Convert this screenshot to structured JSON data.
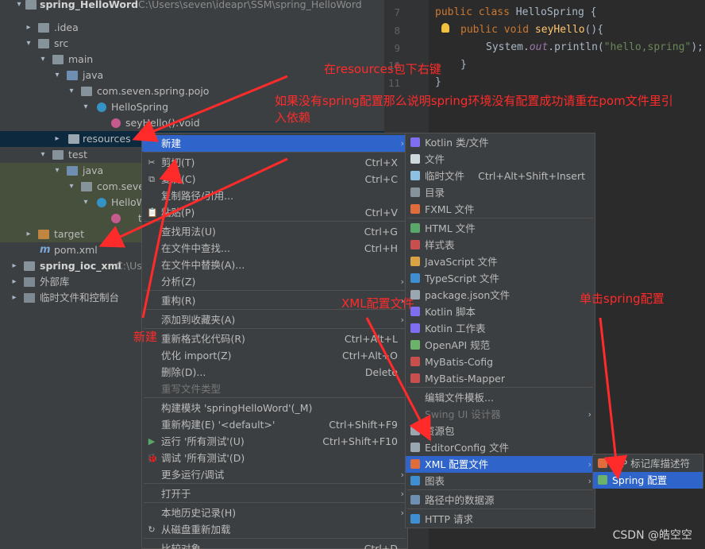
{
  "project_tree": {
    "root_name": "spring_HelloWord",
    "root_path": "C:\\Users\\seven\\ideapr\\SSM\\spring_HelloWord",
    "idea": ".idea",
    "src": "src",
    "main": "main",
    "java": "java",
    "package": "com.seven.spring.pojo",
    "class_name": "HelloSpring",
    "method": "seyHello():void",
    "resources": "resources",
    "test": "test",
    "test_java": "java",
    "test_package": "com.seven",
    "test_class": "HelloW",
    "test_method": "t",
    "target": "target",
    "pom": "pom.xml",
    "module2": "spring_ioc_xml",
    "module2_path": "C:\\Us",
    "ext_libs": "外部库",
    "scratches": "临时文件和控制台"
  },
  "editor": {
    "line_numbers": [
      "7",
      "8",
      "9",
      "10",
      "11"
    ],
    "l7_kw": "public class",
    "l7_name": "HelloSpring {",
    "l8_kw": "public void",
    "l8_fn": "seyHello",
    "l8_rest": "(){",
    "l9_a": "System.",
    "l9_out": "out",
    "l9_b": ".println(",
    "l9_str": "\"hello,spring\"",
    "l9_c": ");",
    "l10": "}",
    "l11": "}"
  },
  "context_menu": {
    "items": [
      {
        "label": "新建",
        "shortcut": "",
        "submenu": true
      },
      {
        "label": "剪切(T)",
        "shortcut": "Ctrl+X",
        "icon": "✂"
      },
      {
        "label": "复制(C)",
        "shortcut": "Ctrl+C",
        "icon": "⧉"
      },
      {
        "label": "复制路径/引用...",
        "shortcut": ""
      },
      {
        "label": "粘贴(P)",
        "shortcut": "Ctrl+V",
        "icon": "📋"
      },
      {
        "label": "查找用法(U)",
        "shortcut": "Ctrl+G"
      },
      {
        "label": "在文件中查找...",
        "shortcut": "Ctrl+H"
      },
      {
        "label": "在文件中替换(A)...",
        "shortcut": ""
      },
      {
        "label": "分析(Z)",
        "shortcut": "",
        "submenu": true
      },
      {
        "label": "重构(R)",
        "shortcut": "",
        "submenu": true
      },
      {
        "label": "添加到收藏夹(A)",
        "shortcut": "",
        "submenu": true
      },
      {
        "label": "重新格式化代码(R)",
        "shortcut": "Ctrl+Alt+L"
      },
      {
        "label": "优化 import(Z)",
        "shortcut": "Ctrl+Alt+O"
      },
      {
        "label": "删除(D)...",
        "shortcut": "Delete"
      },
      {
        "label": "重写文件类型",
        "shortcut": "",
        "disabled": true
      },
      {
        "label": "构建模块 'springHelloWord'(_M)",
        "shortcut": ""
      },
      {
        "label": "重新构建(E) '<default>'",
        "shortcut": "Ctrl+Shift+F9"
      },
      {
        "label": "运行 '所有测试'(U)",
        "shortcut": "Ctrl+Shift+F10",
        "icon": "▶"
      },
      {
        "label": "调试 '所有测试'(D)",
        "shortcut": "",
        "icon": "🐞"
      },
      {
        "label": "更多运行/调试",
        "shortcut": "",
        "submenu": true
      },
      {
        "label": "打开于",
        "shortcut": "",
        "submenu": true
      },
      {
        "label": "本地历史记录(H)",
        "shortcut": "",
        "submenu": true
      },
      {
        "label": "从磁盘重新加载",
        "shortcut": "",
        "icon": "↻"
      },
      {
        "label": "比较对象",
        "shortcut": "Ctrl+D"
      }
    ]
  },
  "new_submenu": {
    "items": [
      {
        "label": "Kotlin 类/文件",
        "icon_color": "#7f6df2",
        "shortcut": ""
      },
      {
        "label": "文件",
        "icon_color": "#cfd8dc",
        "shortcut": ""
      },
      {
        "label": "临时文件",
        "icon_color": "#8ec0e4",
        "shortcut": "Ctrl+Alt+Shift+Insert"
      },
      {
        "label": "目录",
        "icon_color": "#87939a",
        "shortcut": ""
      },
      {
        "label": "FXML 文件",
        "icon_color": "#e06c3c",
        "shortcut": ""
      },
      {
        "label": "HTML 文件",
        "icon_color": "#59a869",
        "shortcut": ""
      },
      {
        "label": "样式表",
        "icon_color": "#c94f4f",
        "shortcut": ""
      },
      {
        "label": "JavaScript 文件",
        "icon_color": "#d9a343",
        "shortcut": ""
      },
      {
        "label": "TypeScript 文件",
        "icon_color": "#3f8ed1",
        "shortcut": ""
      },
      {
        "label": "package.json文件",
        "icon_color": "#9aa7b0",
        "shortcut": ""
      },
      {
        "label": "Kotlin 脚本",
        "icon_color": "#7f6df2",
        "shortcut": ""
      },
      {
        "label": "Kotlin 工作表",
        "icon_color": "#7f6df2",
        "shortcut": ""
      },
      {
        "label": "OpenAPI 规范",
        "icon_color": "#6bb36b",
        "shortcut": ""
      },
      {
        "label": "MyBatis-Cofig",
        "icon_color": "#c94f4f",
        "shortcut": ""
      },
      {
        "label": "MyBatis-Mapper",
        "icon_color": "#c94f4f",
        "shortcut": ""
      },
      {
        "label": "编辑文件模板...",
        "icon_color": "",
        "shortcut": ""
      },
      {
        "label": "Swing UI 设计器",
        "icon_color": "",
        "shortcut": "",
        "disabled": true,
        "submenu": true
      },
      {
        "label": "资源包",
        "icon_color": "#9aa7b0",
        "shortcut": ""
      },
      {
        "label": "EditorConfig 文件",
        "icon_color": "#9aa7b0",
        "shortcut": ""
      },
      {
        "label": "XML 配置文件",
        "icon_color": "#e06c3c",
        "shortcut": "",
        "submenu": true,
        "selected": true
      },
      {
        "label": "图表",
        "icon_color": "#3f8ed1",
        "shortcut": "",
        "submenu": true
      },
      {
        "label": "路径中的数据源",
        "icon_color": "#6e8fb2",
        "shortcut": ""
      },
      {
        "label": "HTTP 请求",
        "icon_color": "#3f8ed1",
        "shortcut": ""
      }
    ]
  },
  "xml_submenu": {
    "items": [
      {
        "label": "JSP 标记库描述符",
        "selected": false
      },
      {
        "label": "Spring 配置",
        "selected": true
      }
    ]
  },
  "annotations": {
    "a1": "在resources包下右键",
    "a2_line1": "如果没有spring配置那么说明spring环境没有配置成功请重在pom文件里引",
    "a2_line2": "入依赖",
    "a3": "新建",
    "a4": "XML配置文件",
    "a5": "单击spring配置"
  },
  "watermark": "CSDN @皓空空",
  "colors": {
    "accent": "#2f65ca",
    "annotation": "#ff2b2b"
  }
}
